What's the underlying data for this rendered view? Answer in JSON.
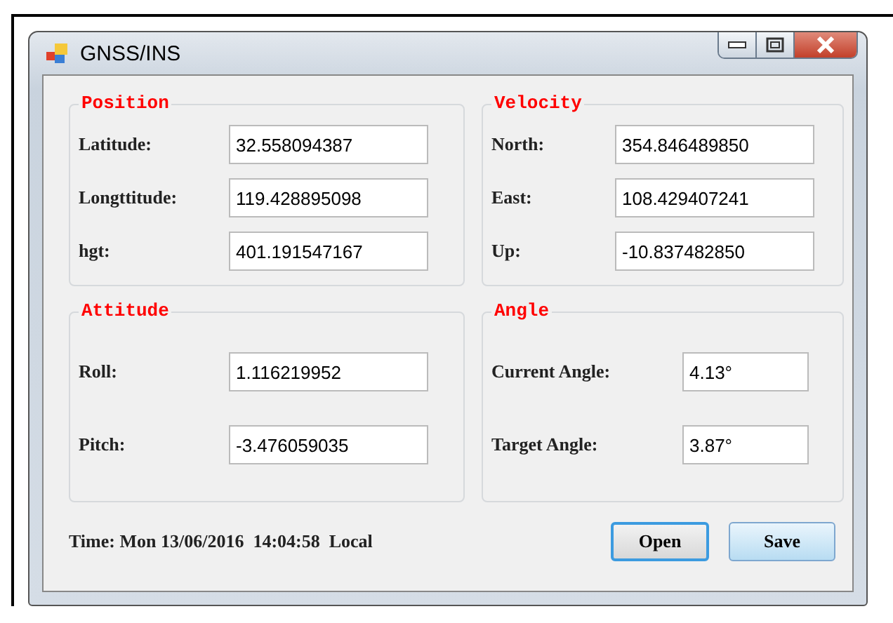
{
  "window": {
    "title": "GNSS/INS"
  },
  "groups": [
    {
      "title": "Position",
      "fields": [
        {
          "label": "Latitude:",
          "value": "32.558094387"
        },
        {
          "label": "Longttitude:",
          "value": "119.428895098"
        },
        {
          "label": "hgt:",
          "value": "401.191547167"
        }
      ]
    },
    {
      "title": "Velocity",
      "fields": [
        {
          "label": "North:",
          "value": "354.846489850"
        },
        {
          "label": "East:",
          "value": "108.429407241"
        },
        {
          "label": "Up:",
          "value": "-10.837482850"
        }
      ]
    },
    {
      "title": "Attitude",
      "fields": [
        {
          "label": "Roll:",
          "value": "1.116219952"
        },
        {
          "label": "Pitch:",
          "value": "-3.476059035"
        }
      ]
    },
    {
      "title": "Angle",
      "fields": [
        {
          "label": "Current Angle:",
          "value": "4.13°"
        },
        {
          "label": "Target Angle:",
          "value": "3.87°"
        }
      ]
    }
  ],
  "status": {
    "time": "Time: Mon 13/06/2016  14:04:58  Local"
  },
  "buttons": [
    {
      "label": "Open",
      "focused": true
    },
    {
      "label": "Save",
      "focused": false
    }
  ]
}
